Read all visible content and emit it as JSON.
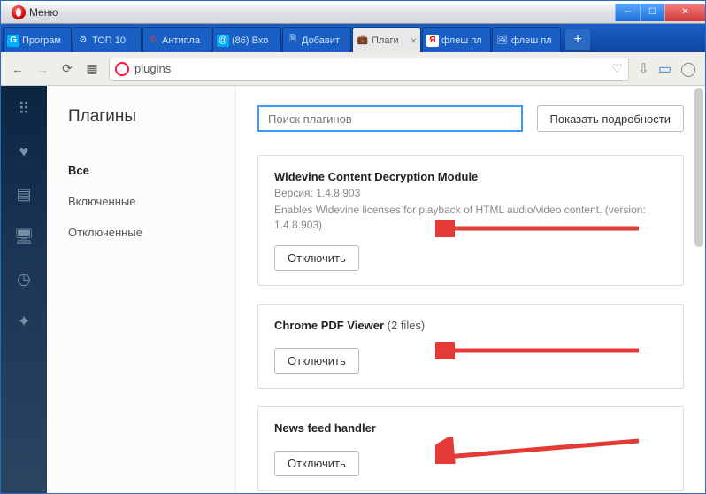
{
  "window": {
    "menu_label": "Меню"
  },
  "tabs": [
    {
      "label": "Програм",
      "icon_bg": "#00b0ff",
      "icon_text": "G"
    },
    {
      "label": "ТОП 10",
      "icon": "⚙"
    },
    {
      "label": "Антипла",
      "icon_bg": "#e53935",
      "icon_text": "©"
    },
    {
      "label": "(86) Вхо",
      "icon_bg": "#03a9f4",
      "icon_text": "✉"
    },
    {
      "label": "Добавит",
      "icon": "📄"
    },
    {
      "label": "Плаги",
      "icon": "💼",
      "active": true
    },
    {
      "label": "флеш пл",
      "icon_bg": "#ffeb3b",
      "icon_text": "Я"
    },
    {
      "label": "флеш пл",
      "icon": "🖼"
    }
  ],
  "address": {
    "value": "plugins"
  },
  "sidebar": {
    "title": "Плагины",
    "items": [
      {
        "label": "Все",
        "active": true
      },
      {
        "label": "Включенные"
      },
      {
        "label": "Отключенные"
      }
    ]
  },
  "content": {
    "search_placeholder": "Поиск плагинов",
    "details_button": "Показать подробности",
    "plugins": [
      {
        "title": "Widevine Content Decryption Module",
        "version_label": "Версия: 1.4.8.903",
        "description": "Enables Widevine licenses for playback of HTML audio/video content. (version: 1.4.8.903)",
        "button": "Отключить"
      },
      {
        "title": "Chrome PDF Viewer",
        "files_label": " (2 files)",
        "button": "Отключить"
      },
      {
        "title": "News feed handler",
        "button": "Отключить"
      }
    ]
  }
}
